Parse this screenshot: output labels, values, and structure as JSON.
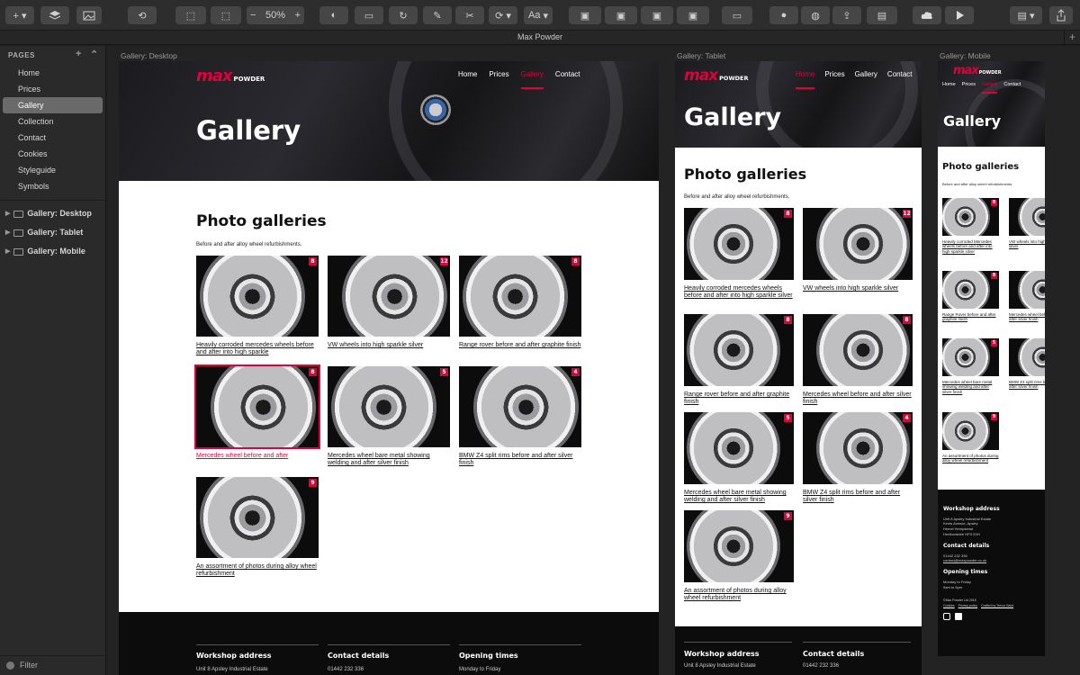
{
  "app": {
    "title": "Max Powder",
    "zoom": "50%",
    "font_button": "Aa"
  },
  "sidebar": {
    "pages_heading": "PAGES",
    "pages": [
      "Home",
      "Prices",
      "Gallery",
      "Collection",
      "Contact",
      "Cookies",
      "Styleguide",
      "Symbols"
    ],
    "active_page": "Gallery",
    "artboards": [
      "Gallery: Desktop",
      "Gallery: Tablet",
      "Gallery: Mobile"
    ],
    "filter_label": "Filter"
  },
  "site": {
    "logo_max": "max",
    "logo_powder": "POWDER",
    "nav": [
      "Home",
      "Prices",
      "Gallery",
      "Contact"
    ],
    "hero_title": "Gallery",
    "section_title": "Photo galleries",
    "intro": "Before and after alloy wheel refurbishments.",
    "galleries": [
      {
        "caption": "Heavily corroded mercedes wheels before and after into high sparkle",
        "caption_tablet": "Heavily corroded mercedes wheels before and after into high sparkle silver",
        "caption_mobile": "Heavily corroded Mercedes wheels before and after into high sparkle silver",
        "count": "8"
      },
      {
        "caption": "VW wheels into high sparkle silver",
        "caption_tablet": "VW wheels into high sparkle silver",
        "caption_mobile": "VW wheels into high sparkle silver",
        "count": "12"
      },
      {
        "caption": "Range rover before and after graphite finish",
        "caption_tablet": "Range rover before and after graphite finish",
        "caption_mobile": "Range Rover before and after graphite finish",
        "count": "8"
      },
      {
        "caption": "Mercedes wheel before and after",
        "caption_tablet": "Mercedes wheel before and after silver finish",
        "caption_mobile": "Mercedes wheel before and after silver finish",
        "count": "8"
      },
      {
        "caption": "Mercedes wheel bare metal showing welding and after silver finish",
        "caption_tablet": "Mercedes wheel bare metal showing welding and after silver finish",
        "caption_mobile": "Mercedes wheel bare metal showing welding and after silver finish",
        "count": "5"
      },
      {
        "caption": "BMW Z4 split rims before and after silver finish",
        "caption_tablet": "BMW Z4 split rims before and after silver finish",
        "caption_mobile": "BMW Z4 split rims before and after silver finish",
        "count": "4"
      },
      {
        "caption": "An assortment of photos during alloy wheel refurbishment",
        "caption_tablet": "An assortment of photos during alloy wheel refurbishment",
        "caption_mobile": "An assortment of photos during alloy wheel refurbishment",
        "count": "9"
      }
    ],
    "footer": {
      "workshop_heading": "Workshop address",
      "address_lines": [
        "Unit 8 Apsley Industrial Estate",
        "Kents Avenue, Apsley",
        "Hemel Hempstead",
        "Hertfordshire HP3 9XH"
      ],
      "contact_heading": "Contact details",
      "phone": "01442 232 336",
      "email": "contact@maxpowder.co.uk",
      "hours_heading": "Opening times",
      "hours_days": "Monday to Friday",
      "hours_time": "9am to 5pm",
      "copyright": "©Max Powder Ltd 2018",
      "links": [
        "Cookies",
        "Privacy policy",
        "Crafted by Trevor Saint"
      ]
    }
  }
}
